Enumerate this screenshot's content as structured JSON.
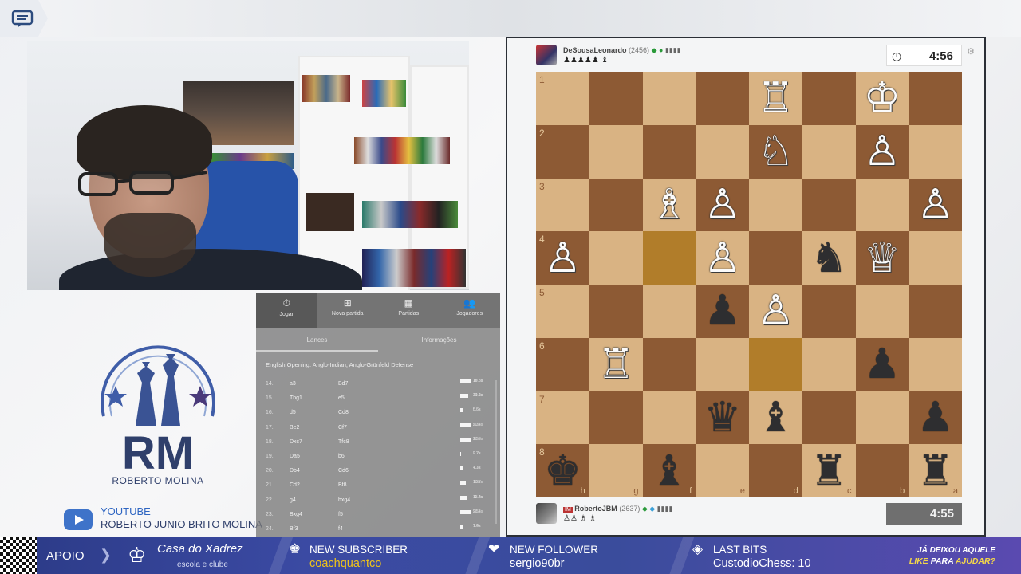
{
  "topbar": {
    "chat_icon": "chat-bubble-icon"
  },
  "branding": {
    "logo_initials": "RM",
    "logo_name": "ROBERTO MOLINA",
    "youtube_label": "YOUTUBE",
    "youtube_channel": "ROBERTO JUNIO BRITO MOLINA"
  },
  "panel": {
    "tabs": [
      {
        "label": "Jogar",
        "icon": "stopwatch-icon"
      },
      {
        "label": "Nova partida",
        "icon": "plus-square-icon"
      },
      {
        "label": "Partidas",
        "icon": "board-icon"
      },
      {
        "label": "Jogadores",
        "icon": "players-icon"
      }
    ],
    "subtabs": [
      "Lances",
      "Informações"
    ],
    "opening": "English Opening: Anglo-Indian, Anglo-Grünfeld Defense",
    "moves": [
      {
        "n": "14.",
        "w": "a3",
        "b": "Bd7",
        "wt": "19.5s",
        "bt": "18.3s",
        "wbar": 0.9,
        "bbar": 0.6
      },
      {
        "n": "15.",
        "w": "Thg1",
        "b": "e5",
        "wt": "10.1s",
        "bt": "21.0s",
        "wbar": 0.5,
        "bbar": 0.7
      },
      {
        "n": "16.",
        "w": "d5",
        "b": "Cd8",
        "wt": "5.6s",
        "bt": "0.5s",
        "wbar": 0.3,
        "bbar": 0.1
      },
      {
        "n": "17.",
        "w": "Be2",
        "b": "Cf7",
        "wt": "20.4s",
        "bt": "5.3s",
        "wbar": 0.9,
        "bbar": 0.3
      },
      {
        "n": "18.",
        "w": "Dxc7",
        "b": "Tfc8",
        "wt": "20.8s",
        "bt": "1.5s",
        "wbar": 0.9,
        "bbar": 0.1
      },
      {
        "n": "19.",
        "w": "Da5",
        "b": "b6",
        "wt": "2.2s",
        "bt": "0.7s",
        "wbar": 0.1,
        "bbar": 0.05
      },
      {
        "n": "20.",
        "w": "Db4",
        "b": "Cd6",
        "wt": "4.7s",
        "bt": "7.3s",
        "wbar": 0.2,
        "bbar": 0.3
      },
      {
        "n": "21.",
        "w": "Cd2",
        "b": "Bf8",
        "wt": "1.3s",
        "bt": "10.7s",
        "wbar": 0.05,
        "bbar": 0.5
      },
      {
        "n": "22.",
        "w": "g4",
        "b": "hxg4",
        "wt": "11.2s",
        "bt": "13.4s",
        "wbar": 0.5,
        "bbar": 0.6
      },
      {
        "n": "23.",
        "w": "Bxg4",
        "b": "f5",
        "wt": "9.5s",
        "bt": "26.4s",
        "wbar": 0.4,
        "bbar": 0.9
      },
      {
        "n": "24.",
        "w": "Bf3",
        "b": "f4",
        "wt": "7.4s",
        "bt": "1.5s",
        "wbar": 0.3,
        "bbar": 0.1
      }
    ]
  },
  "top_player": {
    "name": "DeSousaLeonardo",
    "rating": "(2456)",
    "captured": "♟♟♟♟♟ ♝",
    "clock": "4:56"
  },
  "bottom_player": {
    "title": "IM",
    "name": "RobertoJBM",
    "rating": "(2637)",
    "captured": "♙♙ ♗ ♗",
    "clock": "4:55"
  },
  "board": {
    "orientation": "black",
    "ranks": [
      "1",
      "2",
      "3",
      "4",
      "5",
      "6",
      "7",
      "8"
    ],
    "files": [
      "h",
      "g",
      "f",
      "e",
      "d",
      "c",
      "b",
      "a"
    ],
    "highlight": [
      "f4",
      "d6"
    ],
    "squares": [
      [
        "",
        "",
        "",
        "",
        "wR",
        "",
        "wK",
        ""
      ],
      [
        "",
        "",
        "",
        "",
        "wN",
        "",
        "wP",
        ""
      ],
      [
        "",
        "",
        "wB",
        "wP",
        "",
        "",
        "",
        "wP"
      ],
      [
        "wP",
        "",
        "",
        "wP",
        "",
        "bN",
        "wQ",
        ""
      ],
      [
        "",
        "",
        "",
        "bP",
        "wP",
        "",
        "",
        ""
      ],
      [
        "",
        "wR",
        "",
        "",
        "",
        "",
        "bP",
        ""
      ],
      [
        "",
        "",
        "",
        "bQ",
        "bB",
        "",
        "",
        "bP"
      ],
      [
        "bK",
        "",
        "bB",
        "",
        "",
        "bR",
        "",
        "bR"
      ]
    ]
  },
  "bottombar": {
    "apoio": "APOIO",
    "casa_title": "Casa do Xadrez",
    "casa_sub": "escola e clube",
    "alerts": [
      {
        "header": "NEW SUBSCRIBER",
        "value": "coachquantco",
        "color": "#f0c419",
        "icon": "subscriber-icon"
      },
      {
        "header": "NEW FOLLOWER",
        "value": "sergio90br",
        "color": "#ffffff",
        "icon": "heart-icon"
      },
      {
        "header": "LAST BITS",
        "value": "CustodioChess: 10",
        "color": "#ffffff",
        "icon": "diamond-icon"
      }
    ],
    "cta_line1": "JÁ DEIXOU AQUELE",
    "cta_line2_a": "LIKE",
    "cta_line2_b": "PARA",
    "cta_line2_c": "AJUDAR?"
  }
}
